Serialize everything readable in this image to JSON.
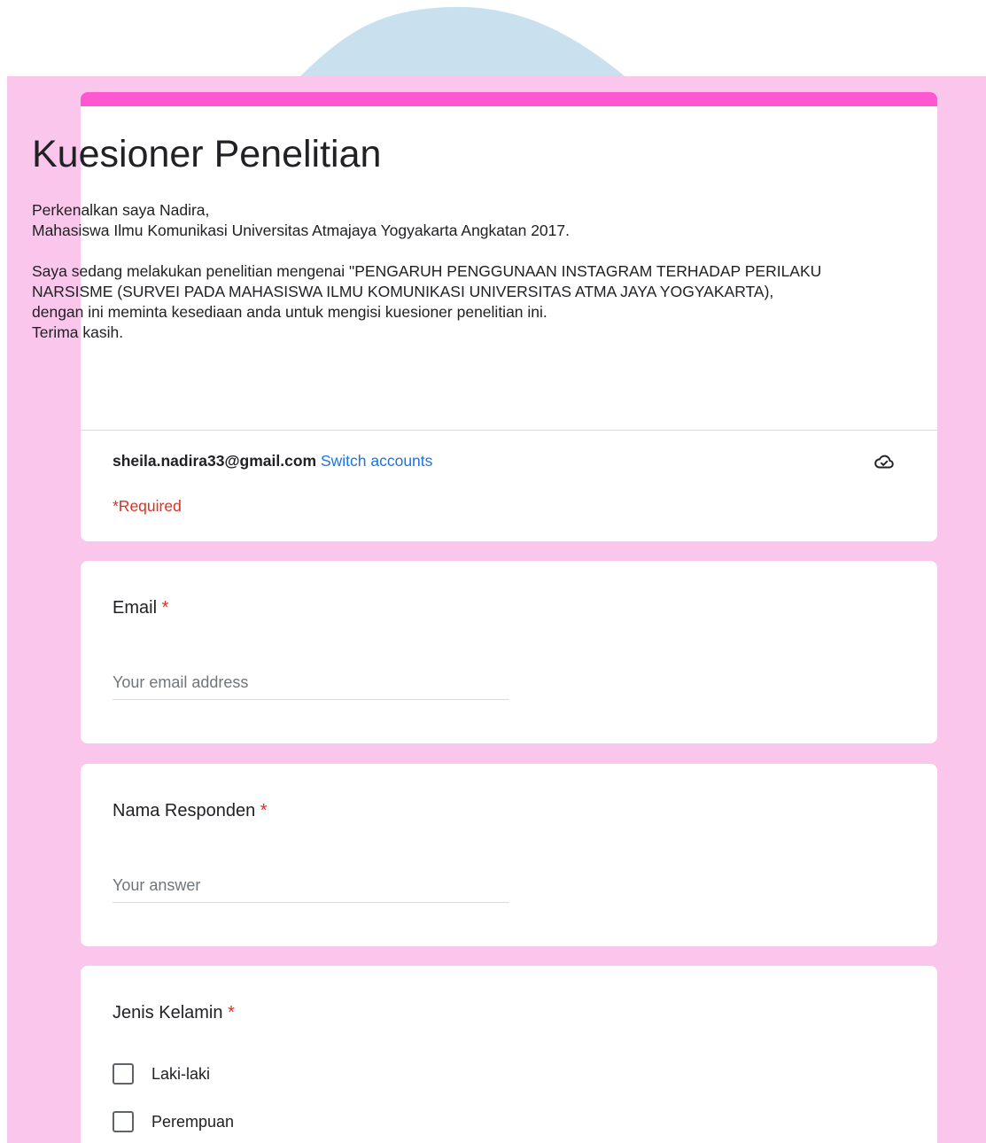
{
  "form": {
    "title": "Kuesioner Penelitian",
    "description": [
      "Perkenalkan saya Nadira,",
      "Mahasiswa Ilmu Komunikasi Universitas Atmajaya Yogyakarta Angkatan 2017.",
      "",
      "Saya sedang melakukan penelitian mengenai \"PENGARUH PENGGUNAAN INSTAGRAM TERHADAP PERILAKU NARSISME (SURVEI PADA MAHASISWA ILMU KOMUNIKASI UNIVERSITAS ATMA JAYA YOGYAKARTA),",
      "dengan ini meminta kesediaan anda untuk mengisi kuesioner penelitian ini.",
      "Terima kasih."
    ],
    "account_email": "sheila.nadira33@gmail.com",
    "switch_accounts": "Switch accounts",
    "required_note": "*Required",
    "accent_color": "#ff57d1",
    "background_color": "#fbc6ec"
  },
  "questions": [
    {
      "label": "Email",
      "required_mark": "*",
      "placeholder": "Your email address",
      "value": ""
    },
    {
      "label": "Nama Responden",
      "required_mark": "*",
      "placeholder": "Your answer",
      "value": ""
    },
    {
      "label": "Jenis Kelamin",
      "required_mark": "*",
      "options": [
        "Laki-laki",
        "Perempuan"
      ]
    }
  ],
  "icons": {
    "cloud": "cloud-saved-icon",
    "checkbox": "checkbox-empty-icon"
  }
}
